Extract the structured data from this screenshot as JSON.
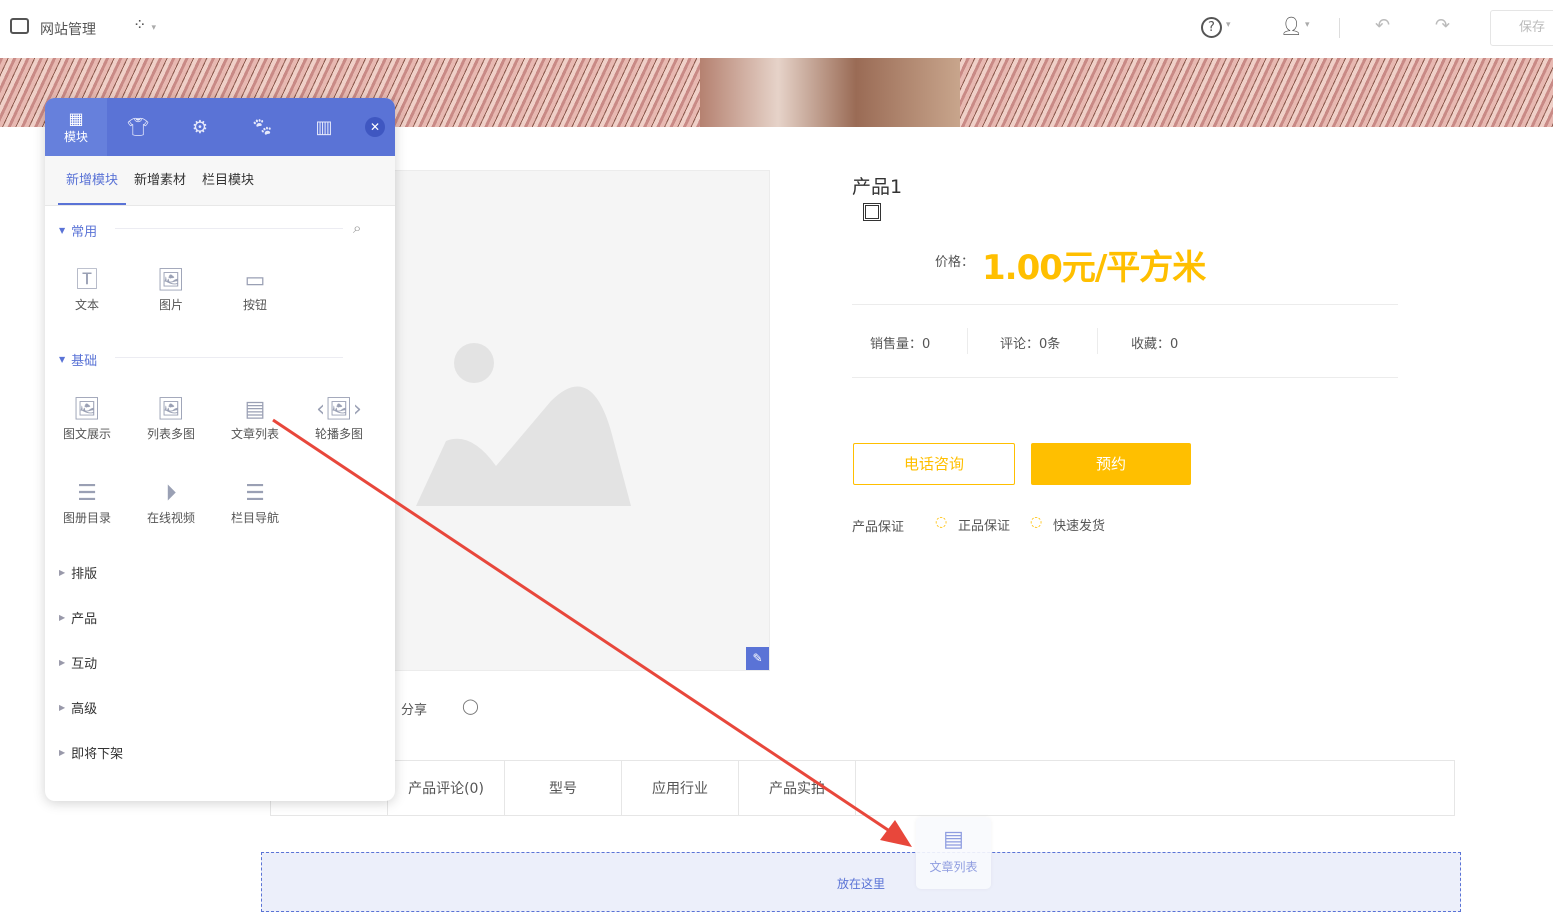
{
  "topbar": {
    "title": "网站管理",
    "save": "保存"
  },
  "panel": {
    "tab_module": "模块",
    "subtabs": [
      "新增模块",
      "新增素材",
      "栏目模块"
    ],
    "common": {
      "label": "常用",
      "items": [
        "文本",
        "图片",
        "按钮"
      ]
    },
    "basic": {
      "label": "基础",
      "items": [
        "图文展示",
        "列表多图",
        "文章列表",
        "轮播多图",
        "图册目录",
        "在线视频",
        "栏目导航"
      ]
    },
    "groups": [
      "排版",
      "产品",
      "互动",
      "高级",
      "即将下架"
    ]
  },
  "product": {
    "title": "产品1",
    "price_label": "价格：",
    "price": "1.00元/平方米",
    "sales": "销售量：0",
    "comments": "评论：0条",
    "favorites": "收藏：0",
    "btn_call": "电话咨询",
    "btn_book": "预约",
    "guarantee_label": "产品保证",
    "guarantees": [
      "正品保证",
      "快速发货"
    ],
    "share": "分享"
  },
  "tabs": [
    "",
    "产品评论(0)",
    "型号",
    "应用行业",
    "产品实拍"
  ],
  "drop": {
    "hint": "放在这里",
    "ghost": "文章列表"
  },
  "colors": {
    "accent": "#5a73d6",
    "price": "#ffbf00",
    "arrow": "#e8473b"
  }
}
